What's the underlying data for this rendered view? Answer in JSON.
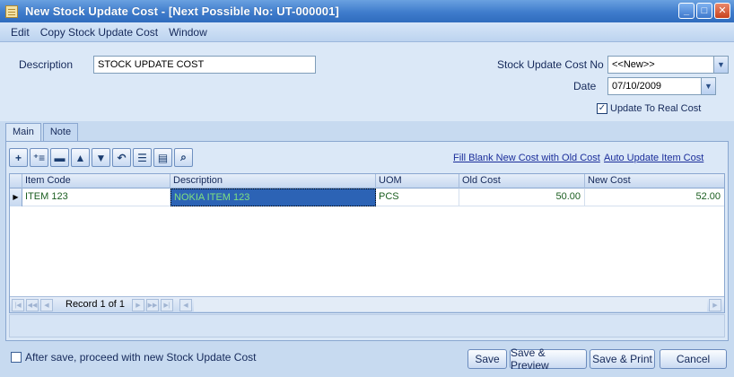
{
  "window": {
    "title": "New Stock Update Cost - [Next Possible No: UT-000001]",
    "minimize": "_",
    "maximize": "□",
    "close": "✕"
  },
  "menu": [
    "Edit",
    "Copy Stock Update Cost",
    "Window"
  ],
  "form": {
    "description_label": "Description",
    "description_value": "STOCK UPDATE COST",
    "cost_no_label": "Stock Update Cost No",
    "cost_no_value": "<<New>>",
    "date_label": "Date",
    "date_value": "07/10/2009",
    "update_real_cost_label": "Update To Real Cost",
    "update_real_cost_checked": true
  },
  "tabs": [
    "Main",
    "Note"
  ],
  "toolbar": {
    "buttons": [
      "add-row-icon",
      "insert-row-icon",
      "delete-row-icon",
      "move-up-icon",
      "move-down-icon",
      "undo-icon",
      "list-icon",
      "columns-icon",
      "search-icon"
    ],
    "links": [
      "Fill Blank New Cost with Old Cost",
      "Auto Update Item Cost"
    ]
  },
  "grid": {
    "columns": [
      "Item Code",
      "Description",
      "UOM",
      "Old Cost",
      "New Cost"
    ],
    "rows": [
      {
        "item_code": "ITEM 123",
        "description": "NOKIA ITEM 123",
        "uom": "PCS",
        "old_cost": "50.00",
        "new_cost": "52.00"
      }
    ],
    "record_text": "Record 1 of 1"
  },
  "footer": {
    "proceed_label": "After save, proceed with new Stock Update Cost",
    "proceed_checked": false,
    "buttons": [
      "Save",
      "Save & Preview",
      "Save & Print",
      "Cancel"
    ]
  }
}
